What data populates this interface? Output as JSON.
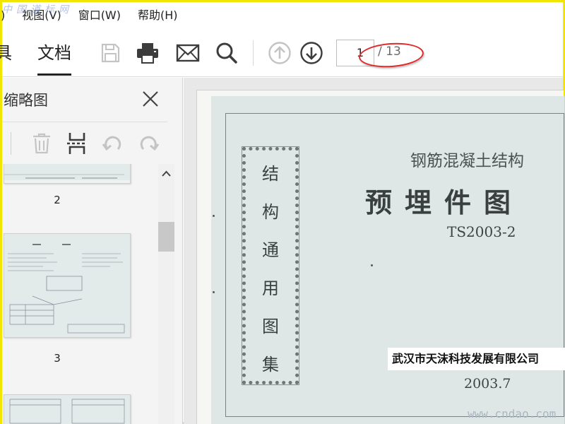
{
  "menu": {
    "items": [
      ")",
      "视图(V)",
      "窗口(W)",
      "帮助(H)"
    ],
    "watermark": "中国道标网"
  },
  "toolbar": {
    "tabs": [
      {
        "label": "具"
      },
      {
        "label": "文档",
        "active": true
      }
    ],
    "buttons": [
      "save-icon",
      "print-icon",
      "email-icon",
      "search-icon",
      "arrow-up-icon",
      "arrow-down-icon"
    ],
    "page_current": "1",
    "page_total": "/ 13"
  },
  "thumbnail_panel": {
    "title": "缩略图",
    "tools": [
      "delete-icon",
      "extract-icon",
      "undo-icon",
      "redo-icon"
    ],
    "pages": [
      {
        "number": "2"
      },
      {
        "number": "3"
      },
      {
        "number": ""
      }
    ]
  },
  "document": {
    "vertical_title": [
      "结",
      "构",
      "通",
      "用",
      "图",
      "集"
    ],
    "subtitle": "钢筋混凝土结构",
    "title": "预埋件图",
    "code": "TS2003-2",
    "company": "武汉市天沫科技发展有限公司",
    "date": "2003.7",
    "watermark": "www.cndao.com"
  },
  "colors": {
    "accent_border": "#f2e600",
    "annotation_circle": "#e02a2a"
  }
}
